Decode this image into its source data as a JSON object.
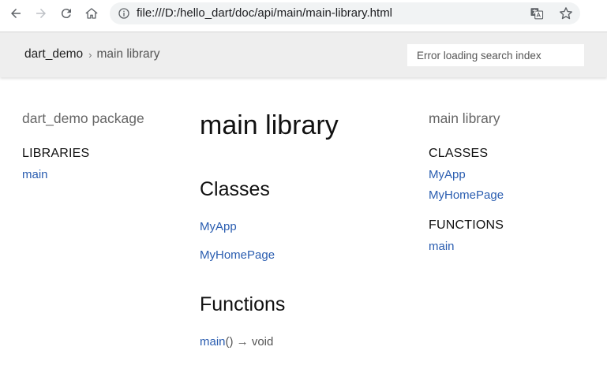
{
  "browser": {
    "url": "file:///D:/hello_dart/doc/api/main/main-library.html"
  },
  "header": {
    "breadcrumb_home": "dart_demo",
    "breadcrumb_separator": "›",
    "breadcrumb_current": "main library",
    "search_placeholder": "Error loading search index"
  },
  "left_sidebar": {
    "package_title": "dart_demo package",
    "libraries_heading": "LIBRARIES",
    "libraries": [
      "main"
    ]
  },
  "main": {
    "title": "main library",
    "classes_heading": "Classes",
    "classes": [
      "MyApp",
      "MyHomePage"
    ],
    "functions_heading": "Functions",
    "function_name": "main",
    "function_sig": "() → void"
  },
  "right_sidebar": {
    "title": "main library",
    "classes_heading": "CLASSES",
    "classes": [
      "MyApp",
      "MyHomePage"
    ],
    "functions_heading": "FUNCTIONS",
    "functions": [
      "main"
    ]
  }
}
